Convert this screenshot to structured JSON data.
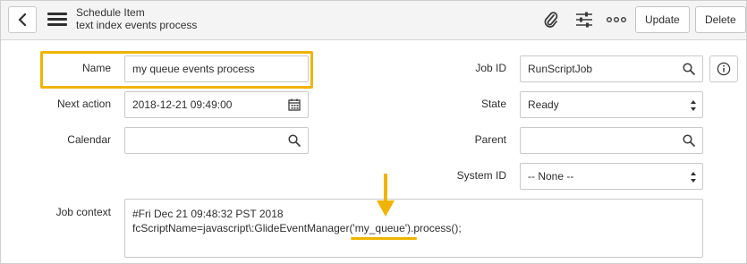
{
  "header": {
    "title": "Schedule Item",
    "subtitle": "text index events process",
    "update_label": "Update",
    "delete_label": "Delete"
  },
  "form": {
    "name": {
      "label": "Name",
      "value": "my queue events process"
    },
    "next_action": {
      "label": "Next action",
      "value": "2018-12-21 09:49:00"
    },
    "calendar": {
      "label": "Calendar",
      "value": ""
    },
    "job_id": {
      "label": "Job ID",
      "value": "RunScriptJob"
    },
    "state": {
      "label": "State",
      "value": "Ready"
    },
    "parent": {
      "label": "Parent",
      "value": ""
    },
    "system_id": {
      "label": "System ID",
      "value": "-- None --"
    },
    "job_context": {
      "label": "Job context",
      "line1": "#Fri Dec 21 09:48:32 PST 2018",
      "line2": "fcScriptName=javascript\\:GlideEventManager('my_queue').process();"
    }
  },
  "colors": {
    "highlight": "#f0b400"
  },
  "icons": [
    "chevron-left-icon",
    "hamburger-menu-icon",
    "paperclip-icon",
    "sliders-icon",
    "more-icon",
    "calendar-icon",
    "search-icon",
    "info-icon",
    "select-arrows-icon",
    "down-arrow-icon"
  ]
}
